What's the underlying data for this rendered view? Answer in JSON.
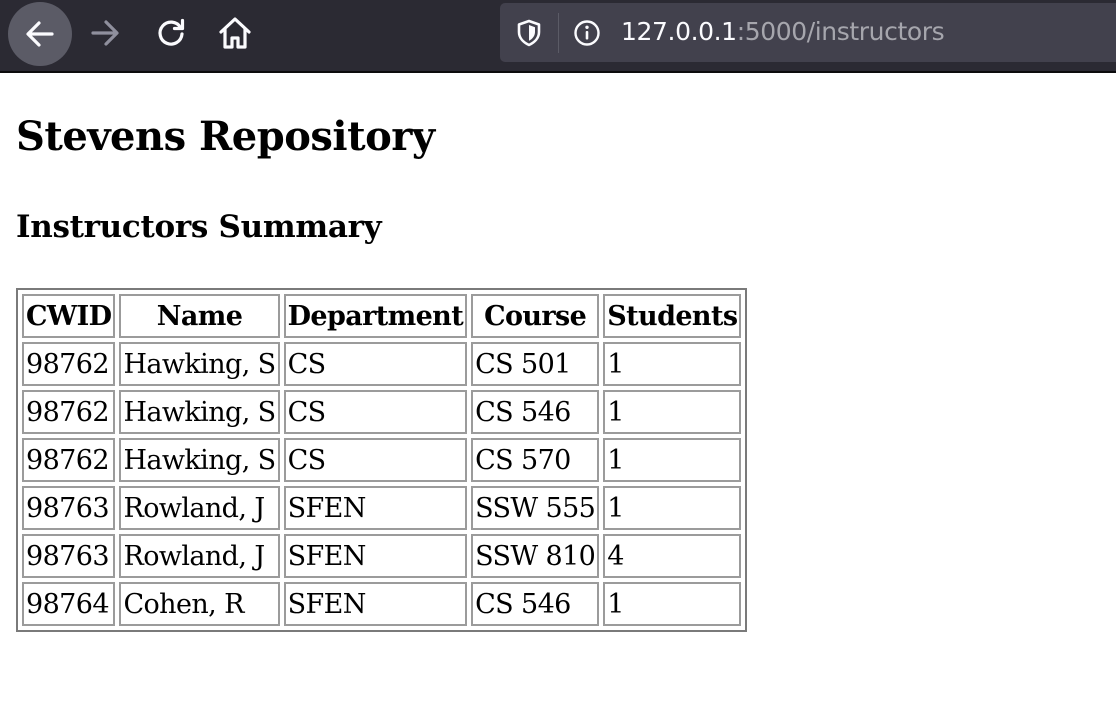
{
  "browser": {
    "url_host": "127.0.0.1",
    "url_path": ":5000/instructors"
  },
  "page": {
    "title": "Stevens Repository",
    "subtitle": "Instructors Summary"
  },
  "table": {
    "headers": [
      "CWID",
      "Name",
      "Department",
      "Course",
      "Students"
    ],
    "rows": [
      [
        "98762",
        "Hawking, S",
        "CS",
        "CS 501",
        "1"
      ],
      [
        "98762",
        "Hawking, S",
        "CS",
        "CS 546",
        "1"
      ],
      [
        "98762",
        "Hawking, S",
        "CS",
        "CS 570",
        "1"
      ],
      [
        "98763",
        "Rowland, J",
        "SFEN",
        "SSW 555",
        "1"
      ],
      [
        "98763",
        "Rowland, J",
        "SFEN",
        "SSW 810",
        "4"
      ],
      [
        "98764",
        "Cohen, R",
        "SFEN",
        "CS 546",
        "1"
      ]
    ]
  },
  "icons": {
    "back": "arrow-left-icon",
    "forward": "arrow-right-icon",
    "reload": "reload-icon",
    "home": "home-icon",
    "tracking": "shield-icon",
    "site_info": "info-icon"
  },
  "colors": {
    "toolbar_bg": "#2b2a33",
    "urlbar_bg": "#42414d",
    "icon_fg": "#fbfbfe",
    "icon_disabled": "#8f8f9d"
  }
}
